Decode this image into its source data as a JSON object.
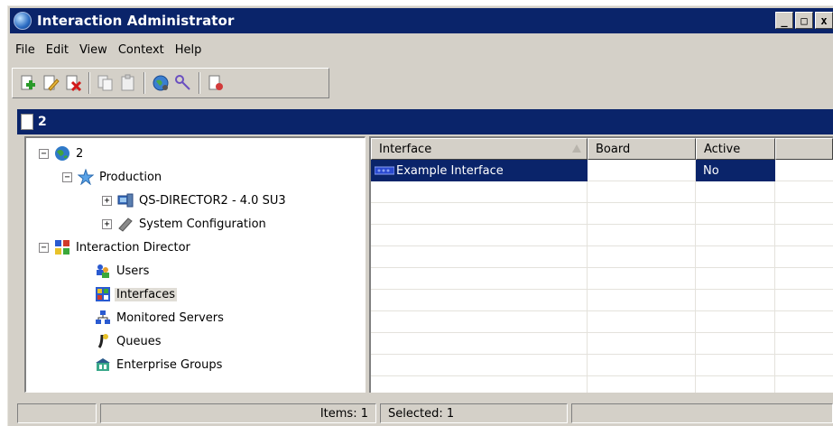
{
  "window": {
    "title": "Interaction Administrator",
    "buttons": {
      "minimize": "_",
      "maximize": "□",
      "close": "x"
    }
  },
  "menu": [
    "File",
    "Edit",
    "View",
    "Context",
    "Help"
  ],
  "toolbar": {
    "buttons": [
      "new-icon",
      "edit-icon",
      "delete-icon",
      "copy-icon",
      "paste-icon",
      "globe-icon",
      "key-icon",
      "report-icon"
    ]
  },
  "document": {
    "title": "2"
  },
  "tree": {
    "root": "2",
    "production": "Production",
    "server": "QS-DIRECTOR2 - 4.0 SU3",
    "system_configuration": "System Configuration",
    "interaction_director": "Interaction Director",
    "users": "Users",
    "interfaces": "Interfaces",
    "monitored_servers": "Monitored Servers",
    "queues": "Queues",
    "enterprise_groups": "Enterprise Groups",
    "expand": "+",
    "collapse": "−"
  },
  "list": {
    "columns": [
      "Interface",
      "Board",
      "Active"
    ],
    "rows": [
      {
        "interface": "Example Interface",
        "board": "",
        "active": "No"
      }
    ]
  },
  "status": {
    "items": "Items: 1",
    "selected": "Selected: 1"
  },
  "colors": {
    "title_bar": "#0a246a",
    "chrome": "#d4d0c8",
    "selection": "#0a246a"
  }
}
